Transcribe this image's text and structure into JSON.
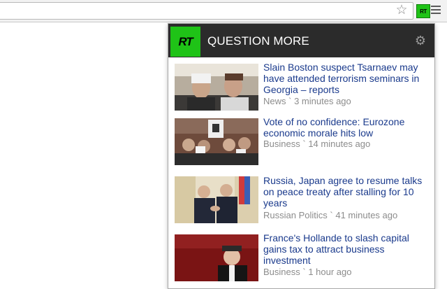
{
  "browser": {
    "star_icon": "star-icon",
    "extension_label": "RT",
    "menu_icon": "hamburger-menu-icon"
  },
  "popup": {
    "logo_text": "RT",
    "brand": "QUESTION MORE",
    "settings_icon": "gear-icon",
    "colors": {
      "accent": "#1fc317",
      "header": "#2b2b2b",
      "link": "#1a3a8c",
      "meta": "#8c8c8c"
    },
    "articles": [
      {
        "title": "Slain Boston suspect Tsarnaev may have attended terrorism seminars in Georgia – reports",
        "category": "News",
        "time": "3 minutes ago"
      },
      {
        "title": "Vote of no confidence: Eurozone economic morale hits low",
        "category": "Business",
        "time": "14 minutes ago"
      },
      {
        "title": "Russia, Japan agree to resume talks on peace treaty after stalling for 10 years",
        "category": "Russian Politics",
        "time": "41 minutes ago"
      },
      {
        "title": "France's Hollande to slash capital gains tax to attract business investment",
        "category": "Business",
        "time": "1 hour ago"
      }
    ]
  }
}
